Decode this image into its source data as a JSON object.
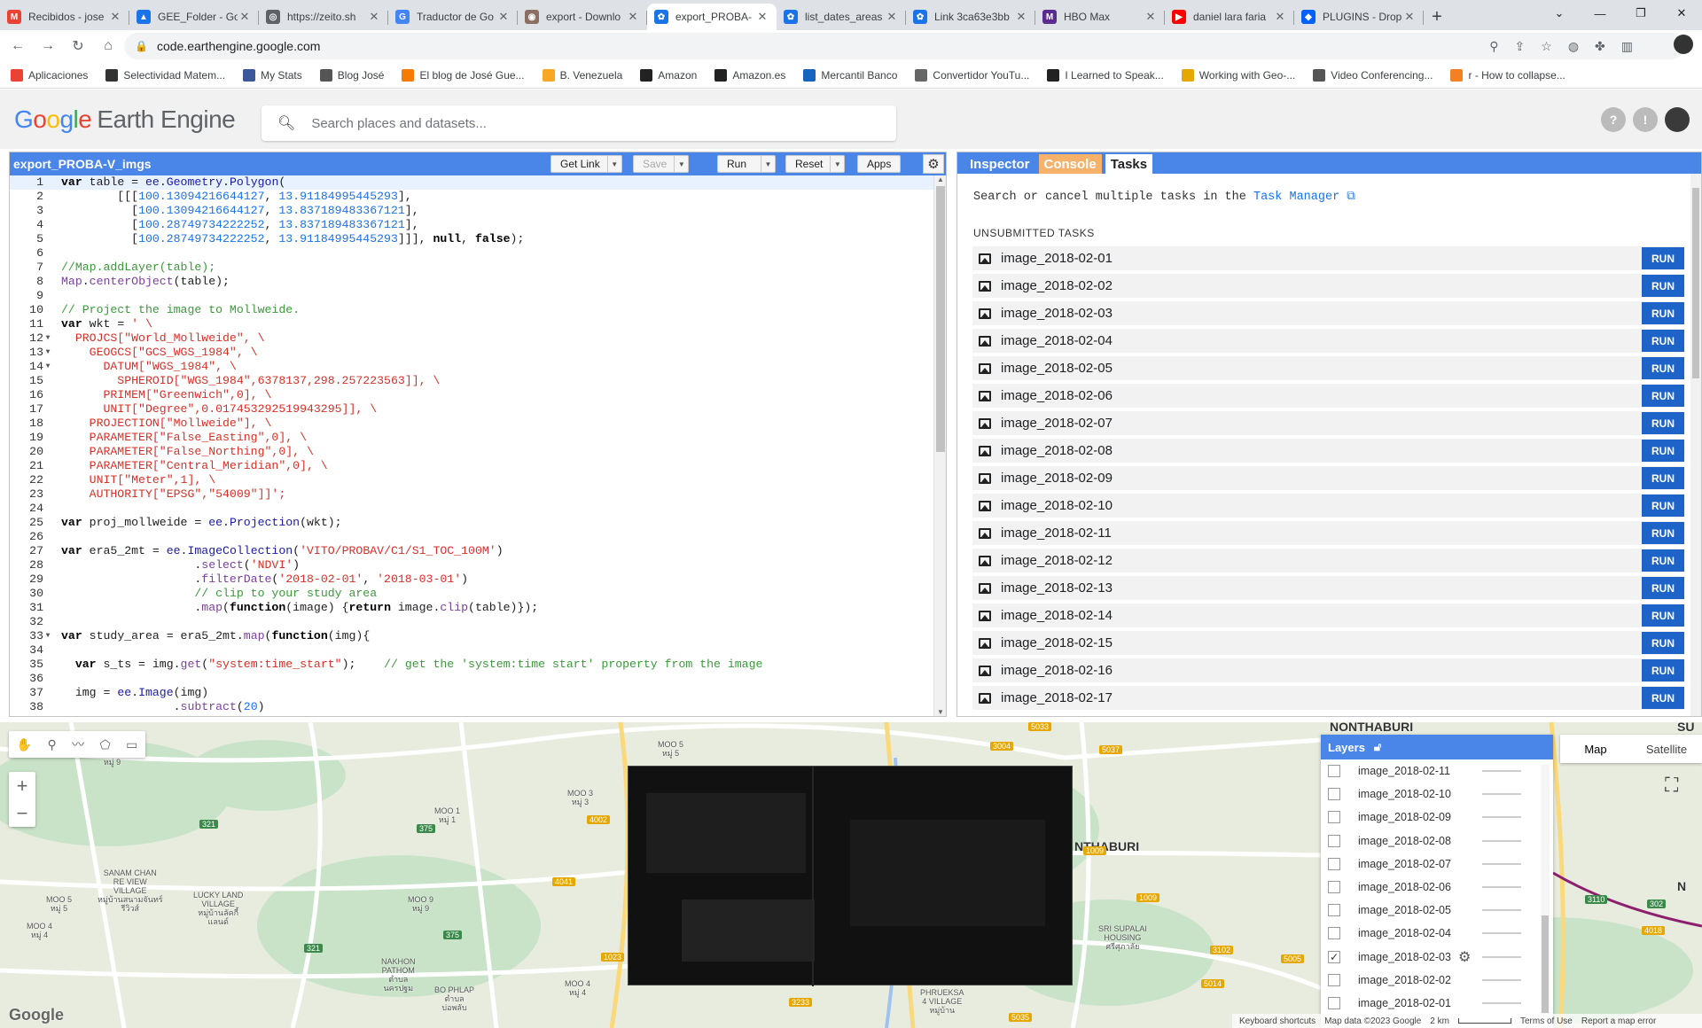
{
  "browser": {
    "tabs": [
      {
        "title": "Recibidos - jose",
        "color": "#ea4335",
        "glyph": "M"
      },
      {
        "title": "GEE_Folder - Go",
        "color": "#1a73e8",
        "glyph": "▲"
      },
      {
        "title": "https://zeito.sh",
        "color": "#5f6368",
        "glyph": "◎"
      },
      {
        "title": "Traductor de Go",
        "color": "#4285f4",
        "glyph": "G"
      },
      {
        "title": "export - Downlo",
        "color": "#8d6e63",
        "glyph": "◉"
      },
      {
        "title": "export_PROBA-",
        "color": "#1a73e8",
        "glyph": "✿"
      },
      {
        "title": "list_dates_areas",
        "color": "#1a73e8",
        "glyph": "✿"
      },
      {
        "title": "Link 3ca63e3bb",
        "color": "#1a73e8",
        "glyph": "✿"
      },
      {
        "title": "HBO Max",
        "color": "#5b2c8d",
        "glyph": "M"
      },
      {
        "title": "daniel lara faria",
        "color": "#ff0000",
        "glyph": "▶"
      },
      {
        "title": "PLUGINS - Drop",
        "color": "#0061fe",
        "glyph": "◆"
      }
    ],
    "active_tab": 5,
    "url": "code.earthengine.google.com",
    "bookmarks": [
      {
        "label": "Aplicaciones",
        "color": "#ea4335"
      },
      {
        "label": "Selectividad Matem...",
        "color": "#333333"
      },
      {
        "label": "My Stats",
        "color": "#3b5998"
      },
      {
        "label": "Blog José",
        "color": "#555555"
      },
      {
        "label": "El blog de José Gue...",
        "color": "#f57c00"
      },
      {
        "label": "B. Venezuela",
        "color": "#f9a825"
      },
      {
        "label": "Amazon",
        "color": "#222222"
      },
      {
        "label": "Amazon.es",
        "color": "#222222"
      },
      {
        "label": "Mercantil Banco",
        "color": "#1565c0"
      },
      {
        "label": "Convertidor YouTu...",
        "color": "#666666"
      },
      {
        "label": "I Learned to Speak...",
        "color": "#222222"
      },
      {
        "label": "Working with Geo-...",
        "color": "#e6a700"
      },
      {
        "label": "Video Conferencing...",
        "color": "#555555"
      },
      {
        "label": "r - How to collapse...",
        "color": "#f48024"
      }
    ]
  },
  "header": {
    "logo_google": "Google",
    "logo_product": "Earth Engine",
    "search_placeholder": "Search places and datasets..."
  },
  "editor": {
    "script_name": "export_PROBA-V_imgs",
    "buttons": {
      "get_link": "Get Link",
      "save": "Save",
      "run": "Run",
      "reset": "Reset",
      "apps": "Apps"
    },
    "lines": [
      "<span class='kw'>var</span> table = <span class='ee'>ee</span>.<span class='ee'>Geometry</span>.<span class='ee'>Polygon</span>(",
      "        [[[<span class='nm'>100.13094216644127</span>, <span class='nm'>13.91184995445293</span>],",
      "          [<span class='nm'>100.13094216644127</span>, <span class='nm'>13.837189483367121</span>],",
      "          [<span class='nm'>100.28749734222252</span>, <span class='nm'>13.837189483367121</span>],",
      "          [<span class='nm'>100.28749734222252</span>, <span class='nm'>13.91184995445293</span>]]], <span class='kw'>null</span>, <span class='kw'>false</span>);",
      "",
      "<span class='cm'>//Map.addLayer(table);</span>",
      "<span class='fn'>Map</span>.<span class='fn'>centerObject</span>(table);",
      "",
      "<span class='cm'>// Project the image to Mollweide.</span>",
      "<span class='kw'>var</span> wkt = <span class='st'>' \\</span>",
      "<span class='st'>  PROJCS[\"World_Mollweide\", \\</span>",
      "<span class='st'>    GEOGCS[\"GCS_WGS_1984\", \\</span>",
      "<span class='st'>      DATUM[\"WGS_1984\", \\</span>",
      "<span class='st'>        SPHEROID[\"WGS_1984\",6378137,298.257223563]], \\</span>",
      "<span class='st'>      PRIMEM[\"Greenwich\",0], \\</span>",
      "<span class='st'>      UNIT[\"Degree\",0.017453292519943295]], \\</span>",
      "<span class='st'>    PROJECTION[\"Mollweide\"], \\</span>",
      "<span class='st'>    PARAMETER[\"False_Easting\",0], \\</span>",
      "<span class='st'>    PARAMETER[\"False_Northing\",0], \\</span>",
      "<span class='st'>    PARAMETER[\"Central_Meridian\",0], \\</span>",
      "<span class='st'>    UNIT[\"Meter\",1], \\</span>",
      "<span class='st'>    AUTHORITY[\"EPSG\",\"54009\"]]';</span>",
      "",
      "<span class='kw'>var</span> proj_mollweide = <span class='ee'>ee</span>.<span class='ee'>Projection</span>(wkt);",
      "",
      "<span class='kw'>var</span> era5_2mt = <span class='ee'>ee</span>.<span class='ee'>ImageCollection</span>(<span class='st'>'VITO/PROBAV/C1/S1_TOC_100M'</span>)",
      "                   .<span class='fn'>select</span>(<span class='st'>'NDVI'</span>)",
      "                   .<span class='fn'>filterDate</span>(<span class='st'>'2018-02-01'</span>, <span class='st'>'2018-03-01'</span>)",
      "                   <span class='cm'>// clip to your study area</span>",
      "                   .<span class='fn'>map</span>(<span class='kw'>function</span>(image) {<span class='kw'>return</span> image.<span class='fn'>clip</span>(table)});",
      "",
      "<span class='kw'>var</span> study_area = era5_2mt.<span class='fn'>map</span>(<span class='kw'>function</span>(img){",
      "",
      "  <span class='kw'>var</span> s_ts = img.<span class='fn'>get</span>(<span class='st'>\"system:time_start\"</span>);    <span class='cm'>// get the 'system:time start' property from the image</span>",
      "",
      "  img = <span class='ee'>ee</span>.<span class='ee'>Image</span>(img)",
      "                .<span class='fn'>subtract</span>(<span class='nm'>20</span>)"
    ],
    "fold_lines": [
      12,
      13,
      14,
      33
    ]
  },
  "right_panel": {
    "tabs": {
      "inspector": "Inspector",
      "console": "Console",
      "tasks": "Tasks"
    },
    "task_manager_prefix": "Search or cancel multiple tasks in the",
    "task_manager_link": "Task Manager",
    "unsubmitted_label": "UNSUBMITTED TASKS",
    "run_label": "RUN",
    "tasks": [
      "image_2018-02-01",
      "image_2018-02-02",
      "image_2018-02-03",
      "image_2018-02-04",
      "image_2018-02-05",
      "image_2018-02-06",
      "image_2018-02-07",
      "image_2018-02-08",
      "image_2018-02-09",
      "image_2018-02-10",
      "image_2018-02-11",
      "image_2018-02-12",
      "image_2018-02-13",
      "image_2018-02-14",
      "image_2018-02-15",
      "image_2018-02-16",
      "image_2018-02-17"
    ]
  },
  "map": {
    "layers_title": "Layers",
    "layers": [
      {
        "name": "image_2018-02-11",
        "checked": false
      },
      {
        "name": "image_2018-02-10",
        "checked": false
      },
      {
        "name": "image_2018-02-09",
        "checked": false
      },
      {
        "name": "image_2018-02-08",
        "checked": false
      },
      {
        "name": "image_2018-02-07",
        "checked": false
      },
      {
        "name": "image_2018-02-06",
        "checked": false
      },
      {
        "name": "image_2018-02-05",
        "checked": false
      },
      {
        "name": "image_2018-02-04",
        "checked": false
      },
      {
        "name": "image_2018-02-03",
        "checked": true
      },
      {
        "name": "image_2018-02-02",
        "checked": false
      },
      {
        "name": "image_2018-02-01",
        "checked": false
      }
    ],
    "map_type": {
      "map": "Map",
      "satellite": "Satellite"
    },
    "footer": {
      "shortcuts": "Keyboard shortcuts",
      "data": "Map data ©2023 Google",
      "scale": "2 km",
      "terms": "Terms of Use",
      "report": "Report a map error"
    },
    "google_logo": "Google",
    "place_labels": [
      {
        "text": "NONTHABURI"
      },
      {
        "text": "MOO 5\nหมู่ 5"
      },
      {
        "text": "MOO 9\nหมู่ 9"
      },
      {
        "text": "MOO 3\nหมู่ 3"
      },
      {
        "text": "MOO 1\nหมู่ 1"
      },
      {
        "text": "SANAM CHAN\nRE VIEW\nVILLAGE\nหมู่บ้านสนามจันทร์\nรีวิวส์"
      },
      {
        "text": "LUCKY LAND\nVILLAGE\nหมู่บ้านลัคกี้\nแลนด์"
      },
      {
        "text": "MOO 5\nหมู่ 5"
      },
      {
        "text": "MOO 4\nหมู่ 4"
      },
      {
        "text": "MOO 9\nหมู่ 9"
      },
      {
        "text": "MOO 4\nหมู่ 4"
      },
      {
        "text": "NAKHON\nPATHOM\nตำบล\nนครปฐม"
      },
      {
        "text": "BO PHLAP\nตำบล\nบ่อพลับ"
      },
      {
        "text": "SRI SUPALAI\nHOUSING\nศรีศุภาลัย"
      },
      {
        "text": "PHRUEKSA\n4 VILLAGE\nหมู่บ้าน"
      },
      {
        "text": "NTHABURI"
      },
      {
        "text": "SU"
      },
      {
        "text": "N"
      }
    ],
    "road_labels": [
      {
        "text": "3004",
        "green": false
      },
      {
        "text": "5037",
        "green": false
      },
      {
        "text": "5033",
        "green": false
      },
      {
        "text": "321",
        "green": true
      },
      {
        "text": "375",
        "green": true
      },
      {
        "text": "4002",
        "green": false
      },
      {
        "text": "4041",
        "green": false
      },
      {
        "text": "375",
        "green": true
      },
      {
        "text": "321",
        "green": true
      },
      {
        "text": "1023",
        "green": false
      },
      {
        "text": "1009",
        "green": false
      },
      {
        "text": "1009",
        "green": false
      },
      {
        "text": "3102",
        "green": false
      },
      {
        "text": "5005",
        "green": false
      },
      {
        "text": "5014",
        "green": false
      },
      {
        "text": "3233",
        "green": false
      },
      {
        "text": "5035",
        "green": false
      },
      {
        "text": "3110",
        "green": true
      },
      {
        "text": "302",
        "green": true
      },
      {
        "text": "4018",
        "green": false
      }
    ]
  }
}
